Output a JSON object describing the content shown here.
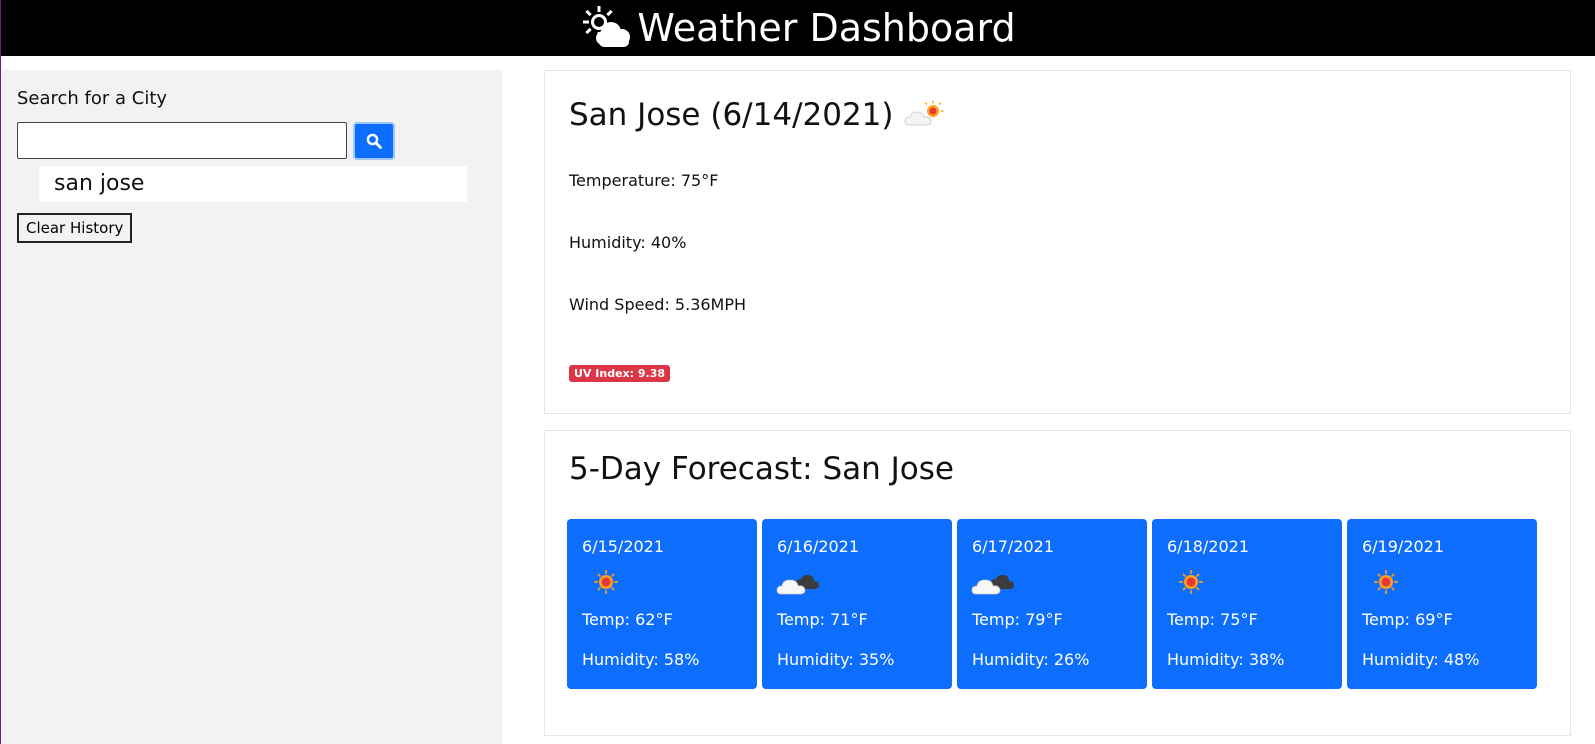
{
  "header": {
    "title": "Weather Dashboard",
    "icon": "sun-cloud-icon"
  },
  "sidebar": {
    "search_label": "Search for a City",
    "search_value": "",
    "search_placeholder": "",
    "search_button_icon": "search-icon",
    "history": [
      "san jose"
    ],
    "clear_label": "Clear History"
  },
  "current": {
    "title": "San Jose (6/14/2021)",
    "icon": "partly-cloudy-icon",
    "temperature": "Temperature: 75°F",
    "humidity": "Humidity: 40%",
    "wind": "Wind Speed: 5.36MPH",
    "uv": "UV Index: 9.38",
    "uv_color": "#dc3545"
  },
  "forecast": {
    "title": "5-Day Forecast: San Jose",
    "card_color": "#0d6efd",
    "days": [
      {
        "date": "6/15/2021",
        "icon": "sun-icon",
        "temp": "Temp: 62°F",
        "humidity": "Humidity: 58%"
      },
      {
        "date": "6/16/2021",
        "icon": "dark-cloud-icon",
        "temp": "Temp: 71°F",
        "humidity": "Humidity: 35%"
      },
      {
        "date": "6/17/2021",
        "icon": "dark-cloud-icon",
        "temp": "Temp: 79°F",
        "humidity": "Humidity: 26%"
      },
      {
        "date": "6/18/2021",
        "icon": "sun-icon",
        "temp": "Temp: 75°F",
        "humidity": "Humidity: 38%"
      },
      {
        "date": "6/19/2021",
        "icon": "sun-icon",
        "temp": "Temp: 69°F",
        "humidity": "Humidity: 48%"
      }
    ]
  }
}
